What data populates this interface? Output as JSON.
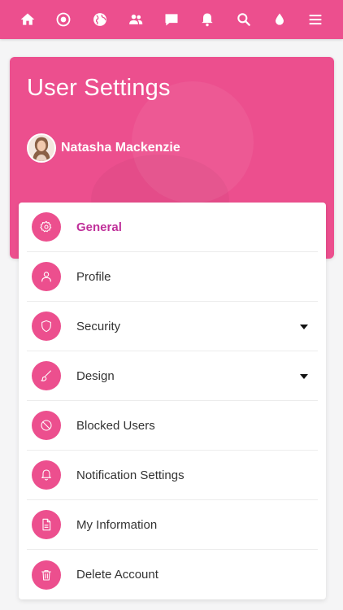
{
  "topbar": {
    "icons": [
      "home-icon",
      "target-icon",
      "globe-icon",
      "people-icon",
      "chat-icon",
      "bell-icon",
      "search-icon",
      "drop-icon",
      "hamburger-menu-icon"
    ]
  },
  "header": {
    "title": "User Settings",
    "user_name": "Natasha Mackenzie"
  },
  "menu": {
    "items": [
      {
        "label": "General",
        "icon": "gear-icon",
        "active": true,
        "has_dropdown": false
      },
      {
        "label": "Profile",
        "icon": "user-icon",
        "active": false,
        "has_dropdown": false
      },
      {
        "label": "Security",
        "icon": "shield-icon",
        "active": false,
        "has_dropdown": true
      },
      {
        "label": "Design",
        "icon": "brush-icon",
        "active": false,
        "has_dropdown": true
      },
      {
        "label": "Blocked Users",
        "icon": "block-icon",
        "active": false,
        "has_dropdown": false
      },
      {
        "label": "Notification Settings",
        "icon": "bell-icon",
        "active": false,
        "has_dropdown": false
      },
      {
        "label": "My Information",
        "icon": "document-icon",
        "active": false,
        "has_dropdown": false
      },
      {
        "label": "Delete Account",
        "icon": "trash-icon",
        "active": false,
        "has_dropdown": false
      }
    ]
  },
  "colors": {
    "accent": "#ec4f8e",
    "active_text": "#c0309a",
    "background": "#f5f5f6"
  }
}
